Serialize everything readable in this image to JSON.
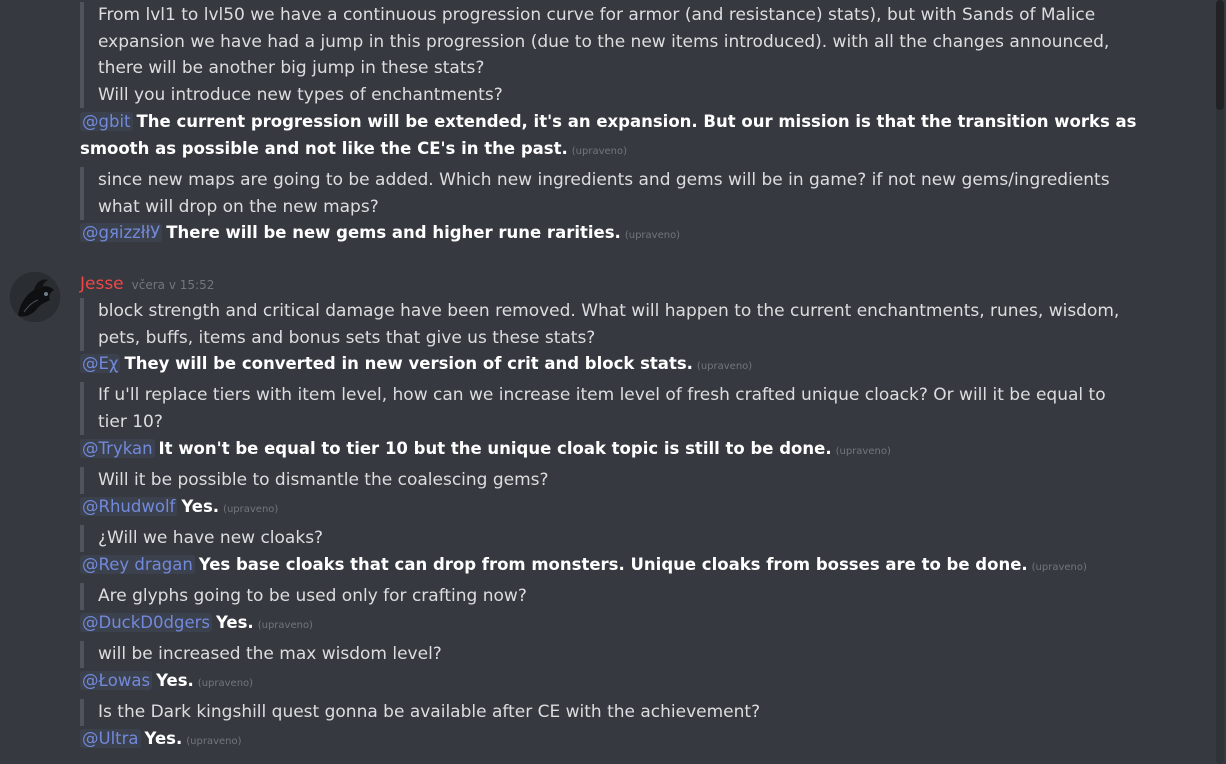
{
  "colors": {
    "background": "#36393f",
    "mention": "#7289da",
    "author": "#f04747",
    "quote_bar": "#4f545c",
    "muted": "#72767d"
  },
  "edited_label": "(upraveno)",
  "top": {
    "q1": [
      "From lvl1 to lvl50 we have a continuous progression curve for armor (and resistance) stats), but with Sands of Malice",
      "expansion we have had a jump in this progression (due to the new items introduced). with all the changes announced,",
      "there will be another big jump in these stats?",
      "Will you introduce new types of enchantments?"
    ],
    "r1_mention": "@gbit",
    "r1_text": "The current progression will be extended, it's an expansion. But our mission is that the transition works as smooth as possible and not like the CE's in the past.",
    "q2": [
      "since new maps are going to be added. Which new ingredients and gems will be in game? if not new gems/ingredients",
      "what will drop on the new maps?"
    ],
    "r2_mention": "@gяizzłłУ",
    "r2_text": "There will be new gems and higher rune rarities."
  },
  "message": {
    "author": "Jesse",
    "timestamp": "včera v 15:52",
    "avatar_icon": "dark-creature-avatar"
  },
  "qa": {
    "q1": [
      "block strength and critical damage have been removed. What will happen to the current enchantments, runes, wisdom,",
      "pets, buffs, items and bonus sets that give us these stats?"
    ],
    "r1_mention": "@Eχ",
    "r1_text": "They will be converted in new version of crit and block stats.",
    "q2": [
      "If u'll replace tiers with item level, how can we increase item level of fresh crafted unique cloack? Or will it be equal to",
      "tier 10?"
    ],
    "r2_mention": "@Trykan",
    "r2_text": "It won't be equal to tier 10 but the unique cloak topic is still to be done.",
    "q3": [
      "Will it be possible to dismantle the coalescing gems?"
    ],
    "r3_mention": "@Rhudwolf",
    "r3_text": "Yes.",
    "q4": [
      "¿Will we have new cloaks?"
    ],
    "r4_mention": "@Rey dragan",
    "r4_text": "Yes base cloaks that can drop from monsters. Unique cloaks from bosses are to be done.",
    "q5": [
      "Are glyphs going to be used only for crafting now?"
    ],
    "r5_mention": "@DuckD0dgers",
    "r5_text": "Yes.",
    "q6": [
      "will be increased the max wisdom level?"
    ],
    "r6_mention": "@Łowas",
    "r6_text": "Yes.",
    "q7": [
      "Is the Dark kingshill quest gonna be available after CE with the achievement?"
    ],
    "r7_mention": "@Ultra",
    "r7_text": "Yes."
  }
}
